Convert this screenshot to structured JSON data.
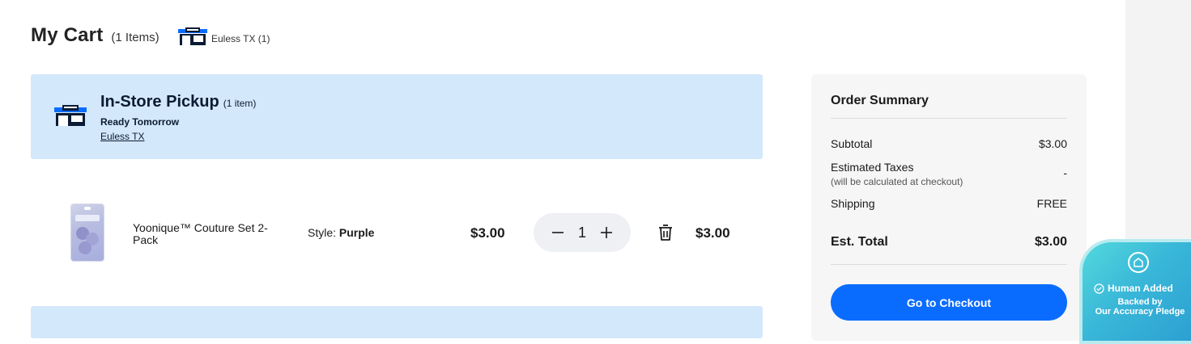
{
  "header": {
    "title": "My Cart",
    "item_count": "(1 Items)",
    "store_chip": "Euless TX (1)"
  },
  "pickup": {
    "title": "In-Store Pickup",
    "item_count": "(1 item)",
    "ready": "Ready Tomorrow",
    "store": "Euless TX"
  },
  "cart_item": {
    "name": "Yoonique™ Couture Set 2-Pack",
    "style_label": "Style:",
    "style_value": "Purple",
    "unit_price": "$3.00",
    "quantity": "1",
    "line_total": "$3.00"
  },
  "summary": {
    "heading": "Order Summary",
    "subtotal_label": "Subtotal",
    "subtotal_value": "$3.00",
    "taxes_label": "Estimated Taxes",
    "taxes_note": "(will be calculated at checkout)",
    "taxes_value": "-",
    "shipping_label": "Shipping",
    "shipping_value": "FREE",
    "total_label": "Est. Total",
    "total_value": "$3.00",
    "checkout_label": "Go to Checkout"
  },
  "badge": {
    "title": "Human Added",
    "line1": "Backed by",
    "line2": "Our Accuracy Pledge"
  },
  "colors": {
    "panel_bg": "#d4e8fb",
    "accent": "#0a6cff",
    "badge": "#39b7d8"
  }
}
